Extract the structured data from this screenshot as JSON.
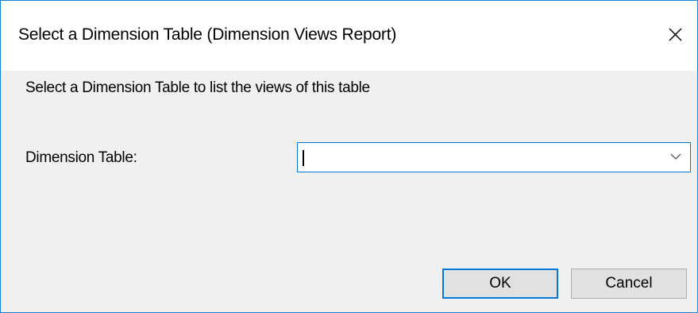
{
  "dialog": {
    "title": "Select a Dimension Table (Dimension Views Report)",
    "close_icon": "close-icon",
    "instruction": "Select a Dimension Table to list the views of this table",
    "field_label": "Dimension Table:",
    "dimension_table": {
      "value": "",
      "dropdown_icon": "chevron-down-icon"
    },
    "buttons": {
      "ok_label": "OK",
      "cancel_label": "Cancel"
    },
    "colors": {
      "accent": "#0078d7",
      "window_border": "#1883d7",
      "client_background": "#f0f0f0",
      "button_face": "#e1e1e1"
    }
  }
}
